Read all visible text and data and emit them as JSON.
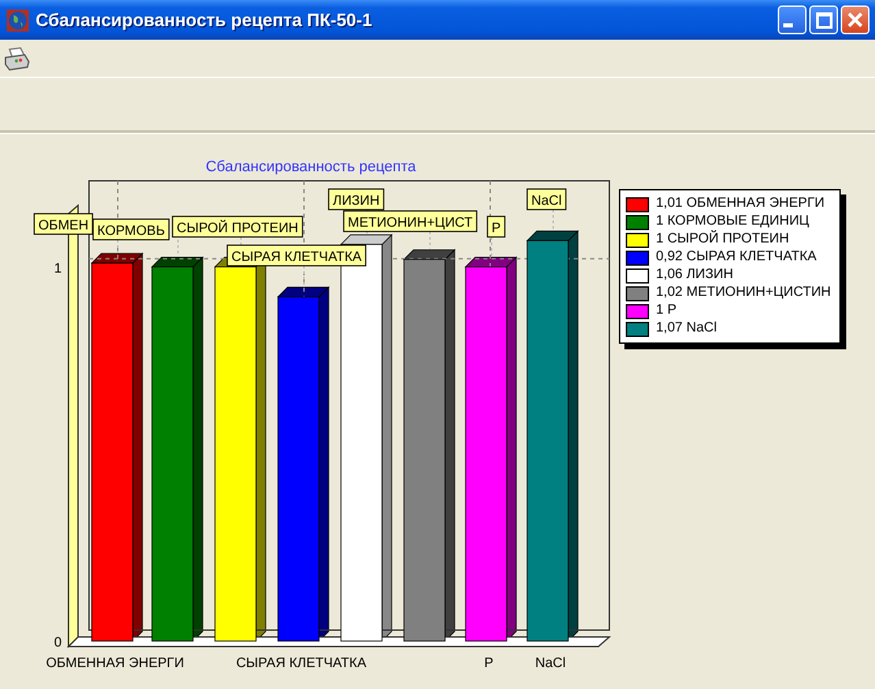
{
  "window": {
    "title": "Сбалансированность рецепта ПК-50-1"
  },
  "chart": {
    "chart_data": {
      "type": "bar",
      "title": "Сбалансированность рецепта",
      "values": [
        1.01,
        1,
        1,
        0.92,
        1.06,
        1.02,
        1,
        1.07
      ],
      "ylim": [
        0,
        1.23
      ],
      "yticks": [
        0,
        1
      ],
      "grid": true
    },
    "bar_callouts": [
      "ЛИЗИН",
      "NaCl",
      "ОБМЕН",
      "КОРМОВЬ",
      "СЫРОЙ ПРОТЕИН",
      "МЕТИОНИН+ЦИСТ",
      "P",
      "СЫРАЯ КЛЕТЧАТКА"
    ],
    "x_axis_labels": [
      "ОБМЕННАЯ ЭНЕРГИ",
      "СЫРАЯ КЛЕТЧАТКА",
      "P",
      "NaCl"
    ],
    "legend": [
      {
        "text": "1,01 ОБМЕННАЯ ЭНЕРГИ",
        "color": "#ff0000"
      },
      {
        "text": "1 КОРМОВЫЕ ЕДИНИЦ",
        "color": "#008000"
      },
      {
        "text": "1 СЫРОЙ ПРОТЕИН",
        "color": "#ffff00"
      },
      {
        "text": "0,92 СЫРАЯ КЛЕТЧАТКА",
        "color": "#0000ff"
      },
      {
        "text": "1,06 ЛИЗИН",
        "color": "#ffffff"
      },
      {
        "text": "1,02 МЕТИОНИН+ЦИСТИН",
        "color": "#808080"
      },
      {
        "text": "1 P",
        "color": "#ff00ff"
      },
      {
        "text": "1,07 NaCl",
        "color": "#008080"
      }
    ]
  }
}
